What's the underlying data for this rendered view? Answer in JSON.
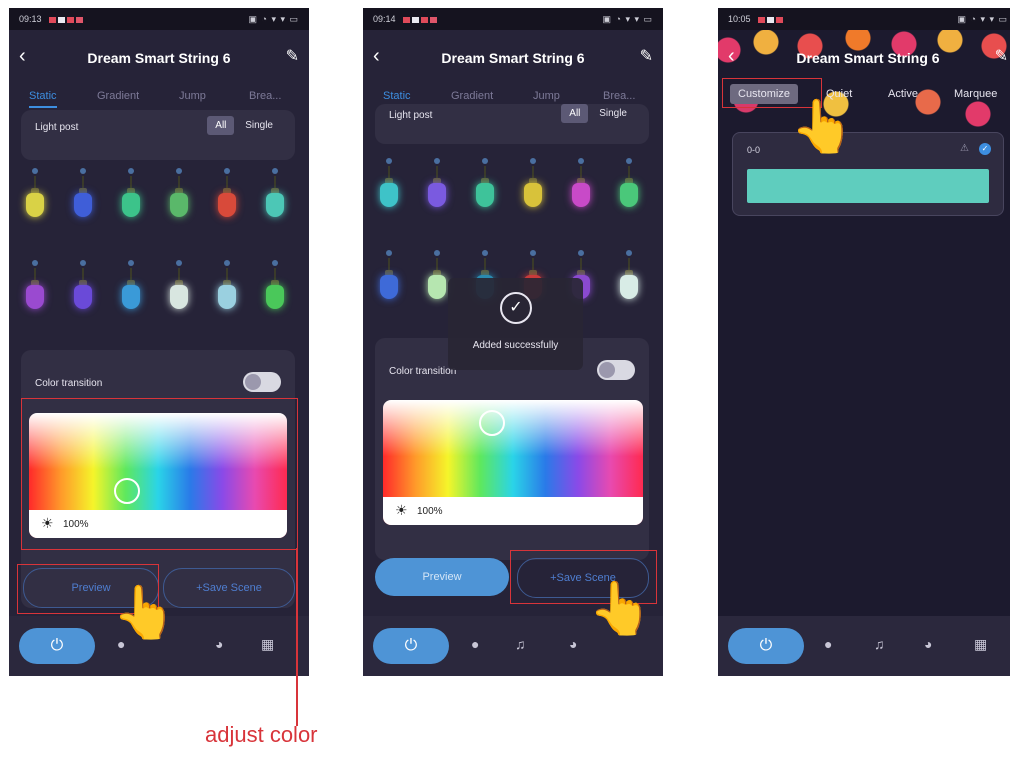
{
  "device_title": "Dream Smart String 6",
  "screens": [
    {
      "status_time": "09:13",
      "tabs": [
        "Static",
        "Gradient",
        "Jump",
        "Brea..."
      ],
      "light_post_label": "Light post",
      "segment": [
        "All",
        "Single"
      ],
      "color_transition_label": "Color transition",
      "brightness": "100%",
      "preview_label": "Preview",
      "save_scene_label": "+Save Scene"
    },
    {
      "status_time": "09:14",
      "tabs": [
        "Static",
        "Gradient",
        "Jump",
        "Brea..."
      ],
      "light_post_label": "Light post",
      "segment": [
        "All",
        "Single"
      ],
      "toast_message": "Added successfully",
      "color_transition_label": "Color transition",
      "brightness": "100%",
      "preview_label": "Preview",
      "save_scene_label": "+Save Scene"
    },
    {
      "status_time": "10:05",
      "tabs": [
        "Customize",
        "Quiet",
        "Active",
        "Marquee"
      ],
      "scene_name": "0-0"
    }
  ],
  "caption": "adjust color",
  "bulbs_screen1": [
    "#d9d246",
    "#3f5ed8",
    "#3cc38a",
    "#5ab86a",
    "#d84a3a",
    "#4cc7b6",
    "#9a4ad0",
    "#6a4ad8",
    "#3a9ad8",
    "#d8e6e0",
    "#9ad0e0",
    "#4ac85a"
  ],
  "bulbs_screen2": [
    "#3ec3c8",
    "#7a5ae0",
    "#3ec39a",
    "#d8c23a",
    "#c84ac8",
    "#4ac87a",
    "#3e6ad8",
    "#b6e6b0",
    "#2a8ab0",
    "#c83a3a",
    "#8a4ad0",
    "#d8ece6"
  ],
  "colors": {
    "accent": "#4e94d6",
    "highlight": "#d8343a",
    "background": "#262338"
  }
}
